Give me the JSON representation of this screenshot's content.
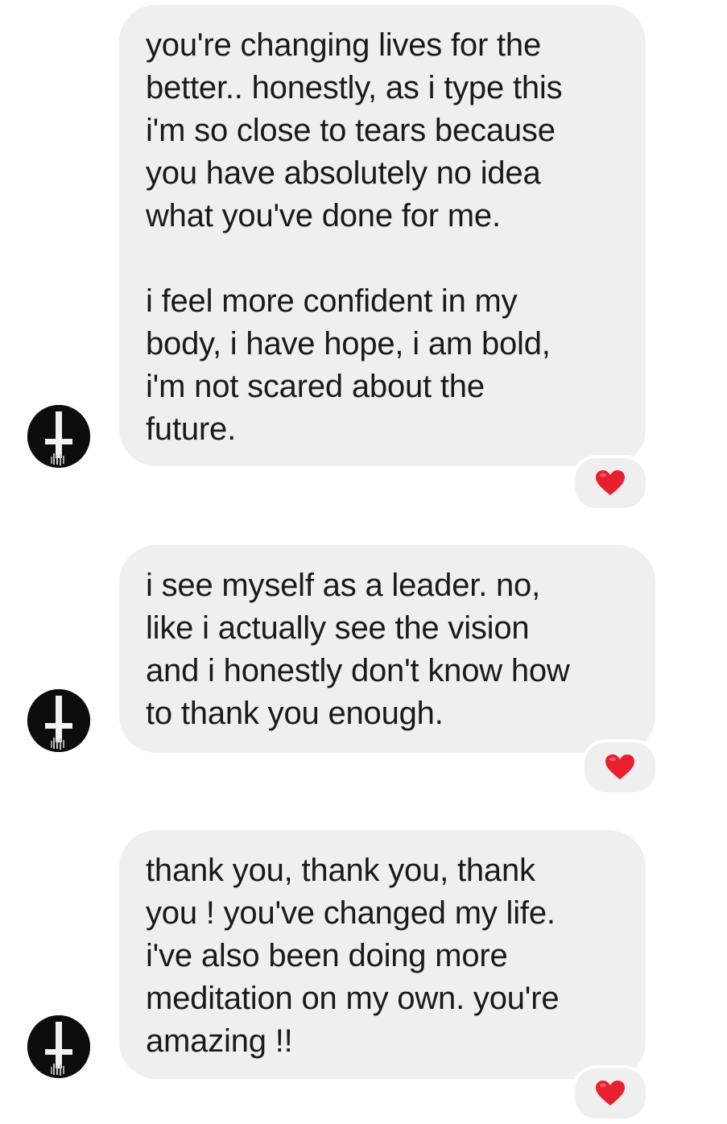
{
  "conversation": {
    "messages": [
      {
        "text": "you're changing lives for the\nbetter.. honestly, as i type this\ni'm so close to tears because\nyou have absolutely no idea\nwhat you've done for me.\n\ni feel more confident in my\nbody, i have hope, i am bold,\ni'm not scared about the\nfuture.",
        "reaction": "heart-icon",
        "sender_avatar": "inverted-cross-avatar"
      },
      {
        "text": "i see myself as a leader. no,\nlike i actually see the vision\nand i honestly don't know how\nto thank you enough.",
        "reaction": "heart-icon",
        "sender_avatar": "inverted-cross-avatar"
      },
      {
        "text": "thank you, thank you, thank\nyou ! you've changed my life.\ni've also been doing more\nmeditation on my own. you're\namazing !!",
        "reaction": "heart-icon",
        "sender_avatar": "inverted-cross-avatar"
      }
    ]
  },
  "colors": {
    "bubble_background": "#efefef",
    "text": "#1a1a1a",
    "heart": "#e8202e",
    "avatar_background": "#0d0d0d"
  }
}
